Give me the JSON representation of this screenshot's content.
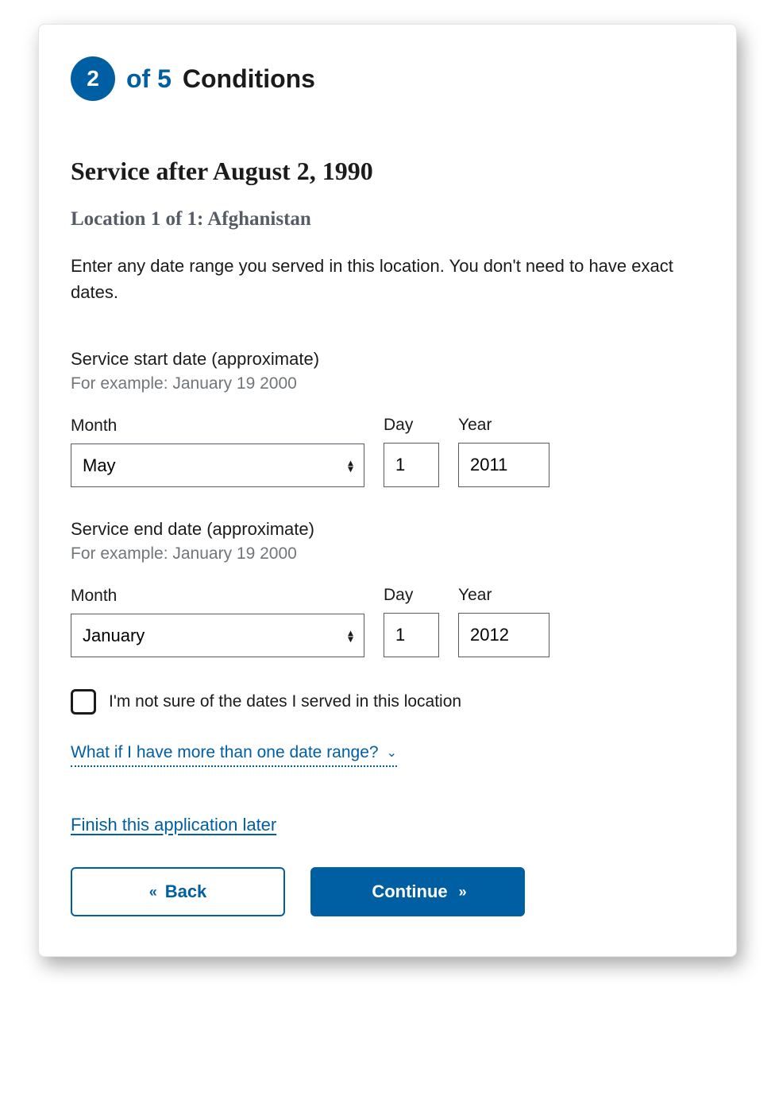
{
  "progress": {
    "current_step": "2",
    "of_label": "of 5",
    "section_title": "Conditions"
  },
  "heading": "Service after August 2, 1990",
  "location_heading": "Location 1 of 1: Afghanistan",
  "instructions": "Enter any date range you served in this location. You don't need to have exact dates.",
  "start": {
    "label": "Service start date (approximate)",
    "hint": "For example: January 19 2000",
    "month_label": "Month",
    "day_label": "Day",
    "year_label": "Year",
    "month_value": "May",
    "day_value": "1",
    "year_value": "2011"
  },
  "end": {
    "label": "Service end date (approximate)",
    "hint": "For example: January 19 2000",
    "month_label": "Month",
    "day_label": "Day",
    "year_label": "Year",
    "month_value": "January",
    "day_value": "1",
    "year_value": "2012"
  },
  "unsure_checkbox_label": "I'm not sure of the dates I served in this location",
  "expander_label": "What if I have more than one date range?",
  "finish_later_label": "Finish this application later",
  "buttons": {
    "back": "Back",
    "continue": "Continue"
  },
  "glyphs": {
    "chev_down": "⌄",
    "double_left": "«",
    "double_right": "»",
    "tri_up": "▴",
    "tri_down": "▾"
  }
}
